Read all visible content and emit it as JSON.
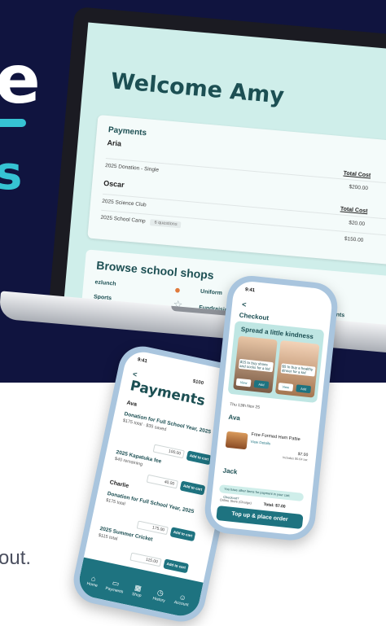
{
  "hero": {
    "big_glyph": "e",
    "small_glyph": "s"
  },
  "bottom_text": "out.",
  "laptop": {
    "welcome": "Welcome Amy",
    "payments_title": "Payments",
    "children": [
      {
        "name": "Aria",
        "header": "Total Cost",
        "rows": [
          {
            "label": "2025 Donation - Single",
            "amount": "$200.00",
            "tag": ""
          }
        ]
      },
      {
        "name": "Oscar",
        "header": "Total Cost",
        "rows": [
          {
            "label": "2025 Science Club",
            "amount": "$20.00",
            "tag": ""
          },
          {
            "label": "2025 School Camp",
            "amount": "$150.00",
            "tag": "6 questions"
          }
        ]
      }
    ],
    "browse_title": "Browse school shops",
    "shops": [
      "ezlunch",
      "Uniform",
      "Events",
      "Sports",
      "Fundraising"
    ]
  },
  "phone_a": {
    "time": "9:41",
    "back": "<",
    "balance": "$100",
    "title": "Payments",
    "child1": "Ava",
    "items": [
      {
        "title": "Donation for Full School Year, 2025",
        "sub": "$175 total · $35 saved",
        "qty": "100.00",
        "btn": "Add to cart"
      },
      {
        "title": "2025 Kapatuka fee",
        "sub": "$40 remaining",
        "qty": "40.00",
        "btn": "Add to cart"
      },
      {
        "title": "Donation for Full School Year, 2025",
        "sub": "$175 total",
        "qty": "175.00",
        "btn": "Add to cart"
      },
      {
        "title": "2025 Summer Cricket",
        "sub": "$115 total",
        "qty": "115.00",
        "btn": "Add to cart"
      }
    ],
    "child2": "Charlie",
    "nav": [
      "Home",
      "Payments",
      "Shop",
      "History",
      "Account"
    ]
  },
  "phone_b": {
    "time": "9:41",
    "back": "<",
    "title": "Checkout",
    "kindness_title": "Spread a little kindness",
    "promos": [
      {
        "text": "$15 to buy shoes and socks for a kid",
        "view": "View",
        "add": "Add"
      },
      {
        "text": "$5 to buy a healthy dinner for a kid",
        "view": "View",
        "add": "Add"
      }
    ],
    "date": "Thu 13th Nov 25",
    "child1": "Ava",
    "food_name": "Free Formed Ham Pattie",
    "view_more": "View Details",
    "price": "$7.00",
    "gst": "Includes $0.64 tax",
    "child2": "Jack",
    "info": "You have other items for payment in your cart. Checkout?",
    "online_label": "Online Store (Charge)",
    "total": "Total: $7.00",
    "place_order": "Top up & place order"
  },
  "colors": {
    "navy": "#10143f",
    "teal": "#36c3d3",
    "app_teal": "#1e7380",
    "screen": "#cfeeea"
  }
}
